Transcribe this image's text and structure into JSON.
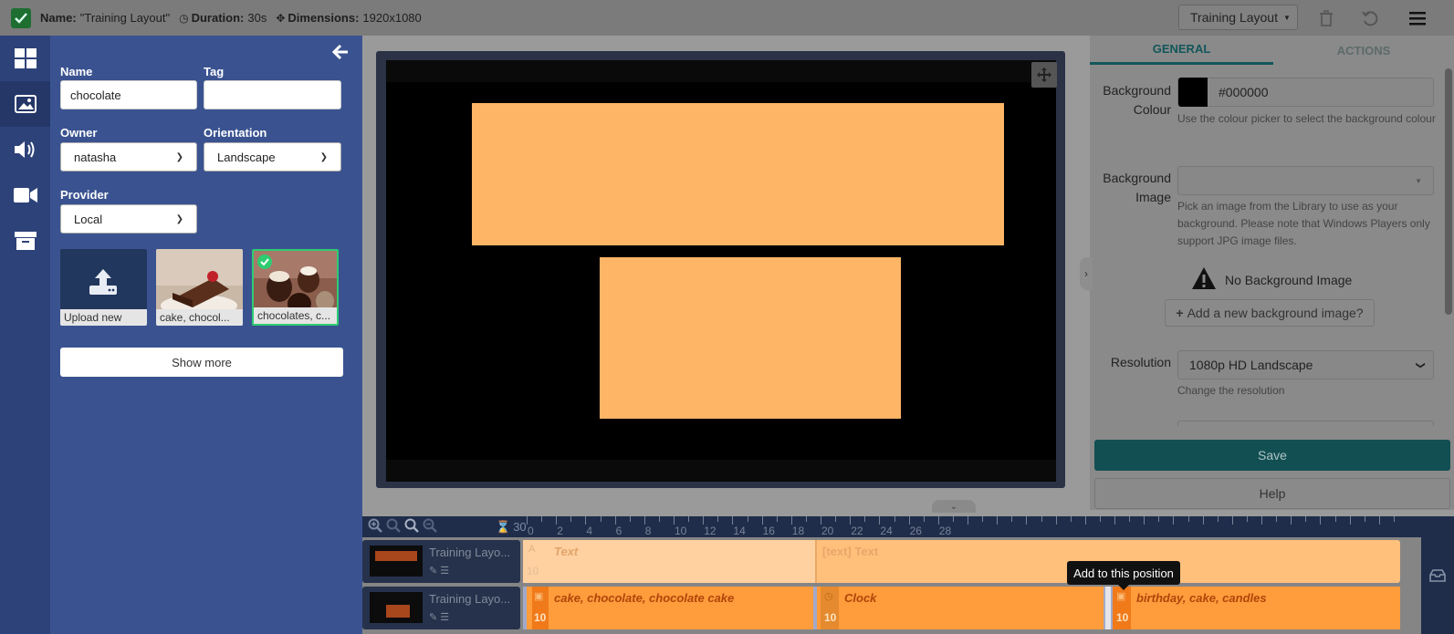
{
  "topbar": {
    "name_label": "Name:",
    "name_value": "\"Training Layout\"",
    "duration_label": "Duration:",
    "duration_value": "30s",
    "dimensions_label": "Dimensions:",
    "dimensions_value": "1920x1080",
    "layout_select": "Training Layout"
  },
  "nav": [
    "layout-icon",
    "image-icon",
    "audio-icon",
    "video-icon",
    "archive-icon"
  ],
  "library": {
    "name_label": "Name",
    "name_value": "chocolate",
    "tag_label": "Tag",
    "tag_value": "",
    "owner_label": "Owner",
    "owner_value": "natasha",
    "orientation_label": "Orientation",
    "orientation_value": "Landscape",
    "provider_label": "Provider",
    "provider_value": "Local",
    "items": [
      {
        "caption": "Upload new"
      },
      {
        "caption": "cake, chocol..."
      },
      {
        "caption": "chocolates, c..."
      }
    ],
    "show_more": "Show more"
  },
  "right_panel": {
    "tab_general": "GENERAL",
    "tab_actions": "ACTIONS",
    "bg_colour_label_1": "Background",
    "bg_colour_label_2": "Colour",
    "bg_colour_value": "#000000",
    "bg_colour_help": "Use the colour picker to select the background colour",
    "bg_image_label_1": "Background",
    "bg_image_label_2": "Image",
    "bg_image_help": "Pick an image from the Library to use as your background. Please note that Windows Players only support JPG image files.",
    "no_bg_image": "No Background Image",
    "add_bg_image": "Add a new background image?",
    "resolution_label": "Resolution",
    "resolution_value": "1080p HD Landscape",
    "resolution_help": "Change the resolution",
    "save": "Save",
    "help": "Help"
  },
  "timeline": {
    "duration_count": "30",
    "ruler_labels": [
      "0",
      "2",
      "4",
      "6",
      "8",
      "10",
      "12",
      "14",
      "16",
      "18",
      "20",
      "22",
      "24",
      "26",
      "28"
    ],
    "tracks": [
      {
        "label": "Training Layo...",
        "widgets": [
          {
            "name": "Text",
            "duration": "10"
          },
          {
            "name": "[text] Text",
            "duration": ""
          }
        ]
      },
      {
        "label": "Training Layo...",
        "widgets": [
          {
            "name": "cake, chocolate, chocolate cake",
            "duration": "10"
          },
          {
            "name": "Clock",
            "duration": "10"
          },
          {
            "name": "birthday, cake, candles",
            "duration": "10"
          }
        ]
      }
    ],
    "tooltip": "Add to this position"
  },
  "colors": {
    "region": "#ffb566",
    "nav": "#2d4278",
    "library": "#3a5390",
    "accent": "#12565a"
  }
}
